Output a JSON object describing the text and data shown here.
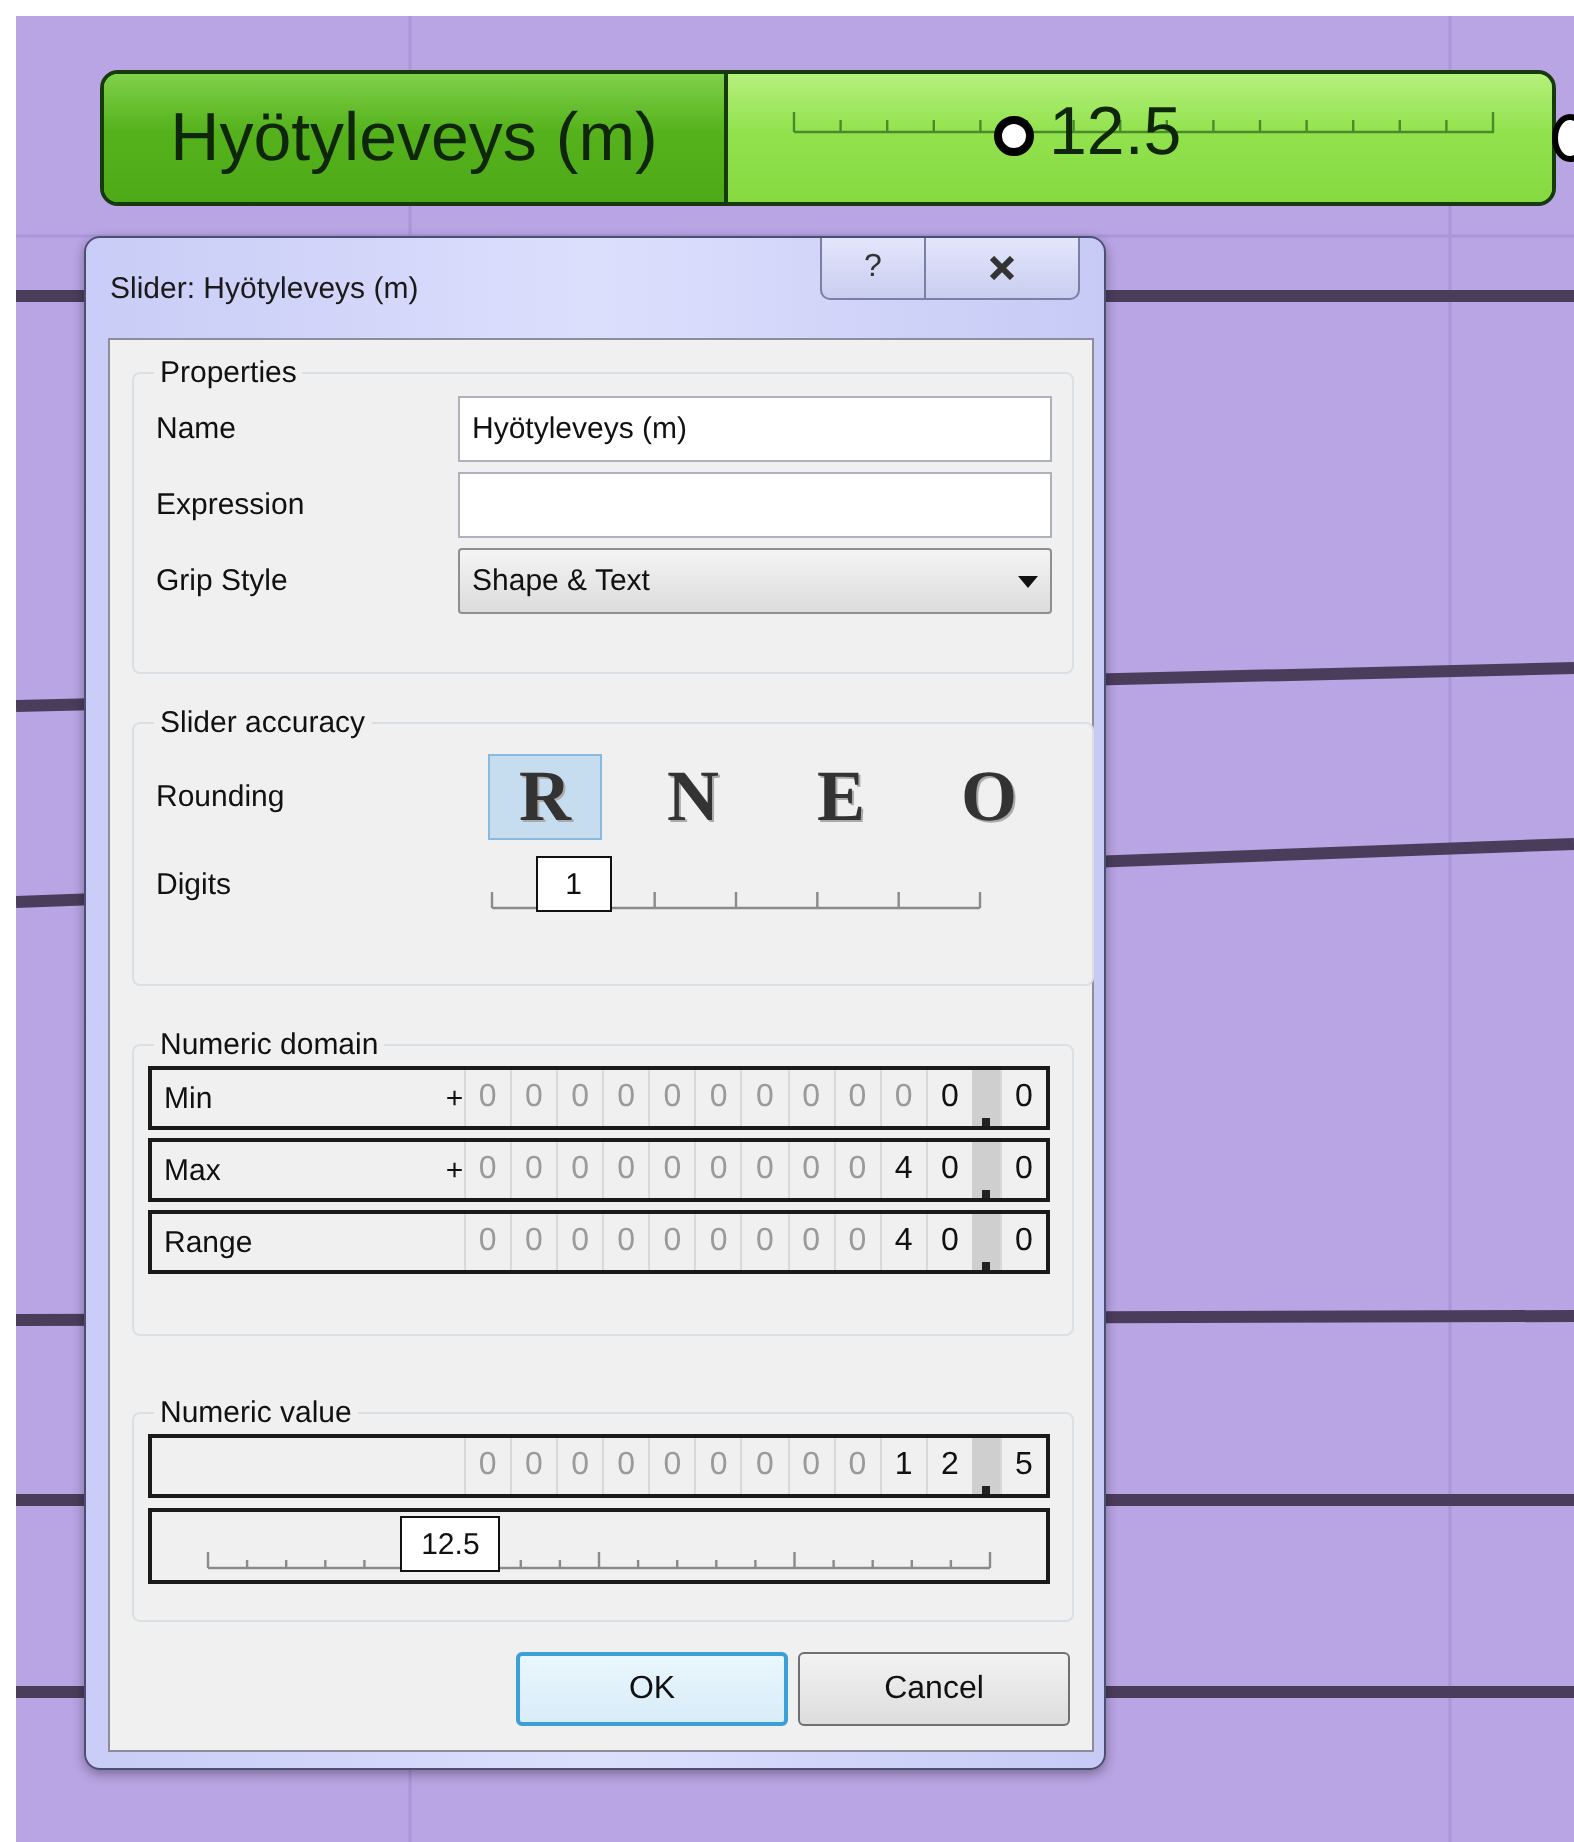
{
  "component": {
    "label": "Hyötyleveys (m)",
    "value": "12.5",
    "level": 0.314
  },
  "dialog": {
    "title": "Slider: Hyötyleveys (m)",
    "help_button": "?",
    "properties": {
      "legend": "Properties",
      "fields": [
        {
          "kind": "text",
          "label": "Name",
          "value": "Hyötyleveys (m)"
        },
        {
          "kind": "text",
          "label": "Expression"
        },
        {
          "kind": "dropdown",
          "label": "Grip Style",
          "value": "Shape & Text"
        }
      ]
    },
    "accuracy": {
      "legend": "Slider accuracy",
      "rounding_label": "Rounding",
      "rounding_options": [
        {
          "label": "R",
          "selected": true
        },
        {
          "label": "N",
          "selected": false
        },
        {
          "label": "E",
          "selected": false
        },
        {
          "label": "O",
          "selected": false
        }
      ],
      "digits_label": "Digits",
      "digits": {
        "value": "1",
        "level": 0.167
      }
    },
    "domain": {
      "legend": "Numeric domain",
      "rows": [
        {
          "label": "Min",
          "sign": "+",
          "digits": [
            {
              "text": "0",
              "dimmed": true
            },
            {
              "text": "0",
              "dimmed": true
            },
            {
              "text": "0",
              "dimmed": true
            },
            {
              "text": "0",
              "dimmed": true
            },
            {
              "text": "0",
              "dimmed": true
            },
            {
              "text": "0",
              "dimmed": true
            },
            {
              "text": "0",
              "dimmed": true
            },
            {
              "text": "0",
              "dimmed": true
            },
            {
              "text": "0",
              "dimmed": true
            },
            {
              "text": "0",
              "dimmed": true
            },
            {
              "text": "0",
              "dimmed": false
            }
          ],
          "fraction": [
            {
              "text": "0",
              "dimmed": false
            }
          ]
        },
        {
          "label": "Max",
          "sign": "+",
          "digits": [
            {
              "text": "0",
              "dimmed": true
            },
            {
              "text": "0",
              "dimmed": true
            },
            {
              "text": "0",
              "dimmed": true
            },
            {
              "text": "0",
              "dimmed": true
            },
            {
              "text": "0",
              "dimmed": true
            },
            {
              "text": "0",
              "dimmed": true
            },
            {
              "text": "0",
              "dimmed": true
            },
            {
              "text": "0",
              "dimmed": true
            },
            {
              "text": "0",
              "dimmed": true
            },
            {
              "text": "4",
              "dimmed": false
            },
            {
              "text": "0",
              "dimmed": false
            }
          ],
          "fraction": [
            {
              "text": "0",
              "dimmed": false
            }
          ]
        },
        {
          "label": "Range",
          "digits": [
            {
              "text": "0",
              "dimmed": true
            },
            {
              "text": "0",
              "dimmed": true
            },
            {
              "text": "0",
              "dimmed": true
            },
            {
              "text": "0",
              "dimmed": true
            },
            {
              "text": "0",
              "dimmed": true
            },
            {
              "text": "0",
              "dimmed": true
            },
            {
              "text": "0",
              "dimmed": true
            },
            {
              "text": "0",
              "dimmed": true
            },
            {
              "text": "0",
              "dimmed": true
            },
            {
              "text": "4",
              "dimmed": false
            },
            {
              "text": "0",
              "dimmed": false
            }
          ],
          "fraction": [
            {
              "text": "0",
              "dimmed": false
            }
          ]
        }
      ]
    },
    "value_group": {
      "legend": "Numeric value",
      "number": {
        "digits": [
          {
            "text": "0",
            "dimmed": true
          },
          {
            "text": "0",
            "dimmed": true
          },
          {
            "text": "0",
            "dimmed": true
          },
          {
            "text": "0",
            "dimmed": true
          },
          {
            "text": "0",
            "dimmed": true
          },
          {
            "text": "0",
            "dimmed": true
          },
          {
            "text": "0",
            "dimmed": true
          },
          {
            "text": "0",
            "dimmed": true
          },
          {
            "text": "0",
            "dimmed": true
          },
          {
            "text": "1",
            "dimmed": false
          },
          {
            "text": "2",
            "dimmed": false
          }
        ],
        "fraction": [
          {
            "text": "5",
            "dimmed": false
          }
        ]
      },
      "slider": {
        "value": "12.5",
        "level": 0.31
      }
    },
    "buttons": [
      {
        "label": "OK",
        "focused": true
      },
      {
        "label": "Cancel",
        "focused": false
      }
    ]
  }
}
